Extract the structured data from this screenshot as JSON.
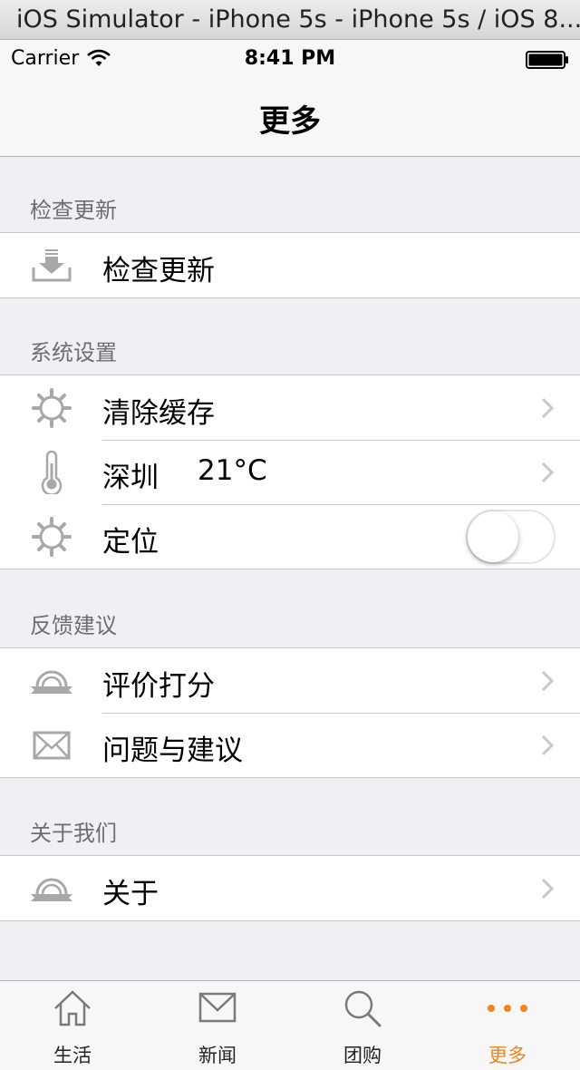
{
  "simulator": {
    "title": "iOS Simulator - iPhone 5s - iPhone 5s / iOS 8...."
  },
  "status_bar": {
    "carrier": "Carrier",
    "time": "8:41 PM"
  },
  "nav": {
    "title": "更多"
  },
  "sections": [
    {
      "header": "检查更新",
      "rows": [
        {
          "label": "检查更新",
          "icon": "download-tray-icon"
        }
      ]
    },
    {
      "header": "系统设置",
      "rows": [
        {
          "label": "清除缓存",
          "icon": "gear-icon"
        },
        {
          "label": "深圳",
          "value": "21°C",
          "icon": "thermometer-icon"
        },
        {
          "label": "定位",
          "icon": "gear-icon",
          "toggle": false
        }
      ]
    },
    {
      "header": "反馈建议",
      "rows": [
        {
          "label": "评价打分",
          "icon": "ribbon-badge-icon"
        },
        {
          "label": "问题与建议",
          "icon": "envelope-icon"
        }
      ]
    },
    {
      "header": "关于我们",
      "rows": [
        {
          "label": "关于",
          "icon": "ribbon-badge-icon"
        }
      ]
    }
  ],
  "tabs": [
    {
      "label": "生活",
      "icon": "home-icon"
    },
    {
      "label": "新闻",
      "icon": "envelope-icon"
    },
    {
      "label": "团购",
      "icon": "search-icon"
    },
    {
      "label": "更多",
      "icon": "more-dots-icon",
      "active": true
    }
  ],
  "colors": {
    "accent": "#f08519",
    "icon_gray": "#a8a8a8",
    "background": "#efeff4"
  }
}
